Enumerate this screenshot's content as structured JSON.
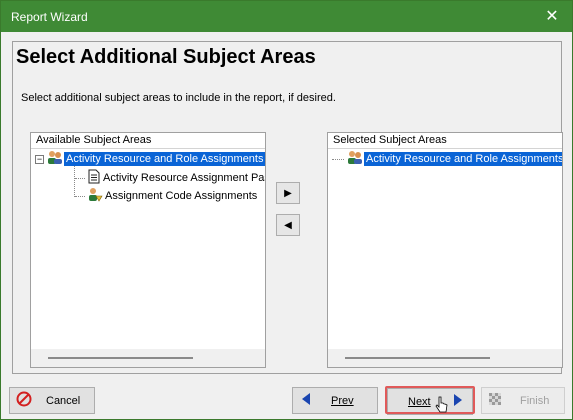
{
  "window": {
    "title": "Report Wizard",
    "close_glyph": "✕"
  },
  "page": {
    "heading": "Select Additional Subject Areas",
    "instructions": "Select additional subject areas to include in the report, if desired."
  },
  "available": {
    "header": "Available Subject Areas",
    "items": [
      {
        "label": "Activity Resource and Role Assignments",
        "icon": "people-icon",
        "selected": true,
        "expander": "−"
      },
      {
        "label": "Activity Resource Assignment Past Period",
        "icon": "document-icon"
      },
      {
        "label": "Assignment Code Assignments",
        "icon": "code-assignment-icon"
      }
    ]
  },
  "selected_list": {
    "header": "Selected Subject Areas",
    "items": [
      {
        "label": "Activity Resource and Role Assignments",
        "icon": "people-icon",
        "selected": true
      }
    ]
  },
  "buttons": {
    "add": "▶",
    "remove": "◀",
    "cancel": "Cancel",
    "prev": "Prev",
    "next": "Next",
    "finish": "Finish"
  },
  "colors": {
    "titlebar": "#3f8a35",
    "selection": "#0a64d6",
    "nav_arrow": "#1a45b0",
    "cancel_icon": "#d32020",
    "highlight": "#e05a5a"
  }
}
